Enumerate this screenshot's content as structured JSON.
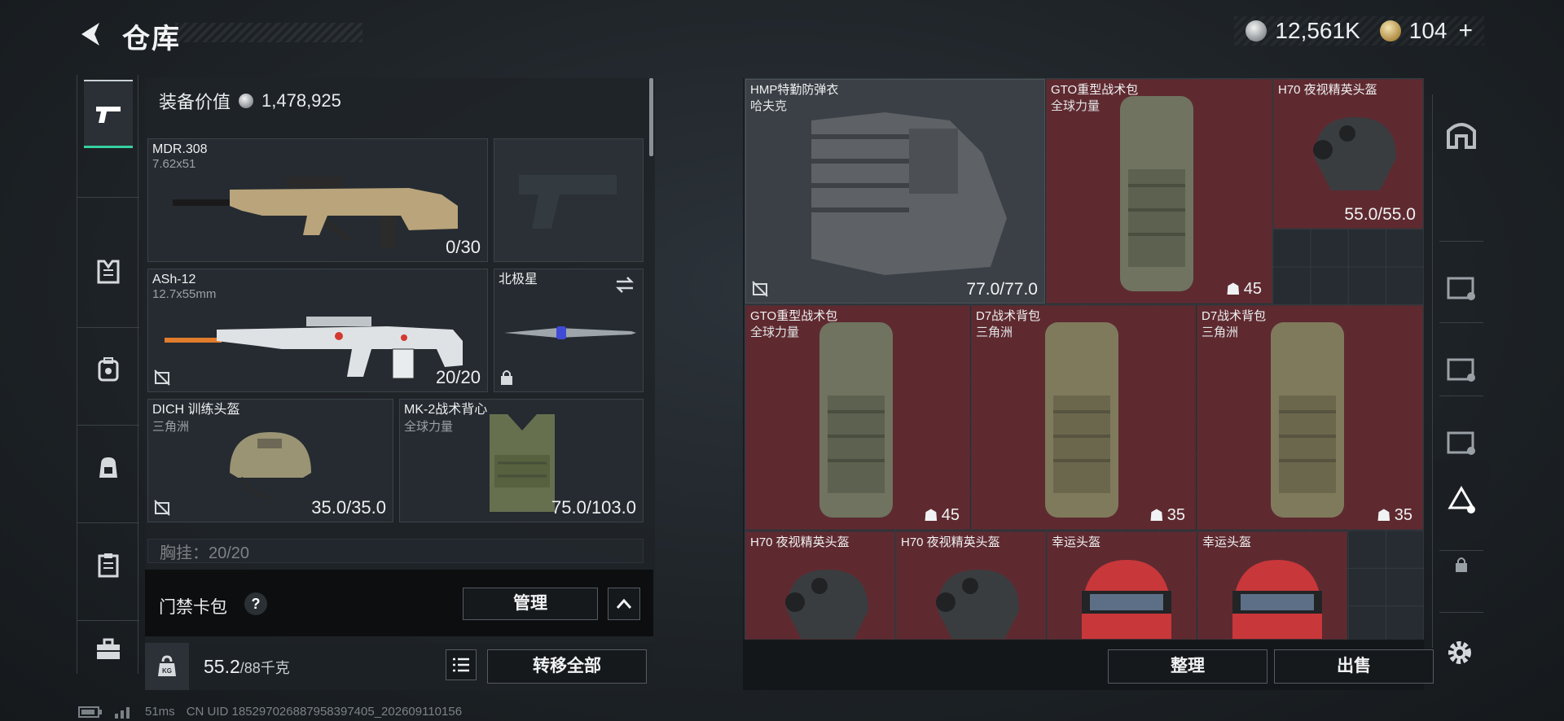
{
  "header": {
    "title": "仓库",
    "currencies": [
      {
        "icon": "silver-coin-icon",
        "value": "12,561K"
      },
      {
        "icon": "gold-coin-icon",
        "value": "104"
      }
    ],
    "add_symbol": "+"
  },
  "left_rail": {
    "tabs": [
      "pistol-icon",
      "armor-icon",
      "backpack-icon",
      "bag-icon",
      "clipboard-icon",
      "toolbox-icon"
    ],
    "active": 0
  },
  "loadout": {
    "equip_value_label": "装备价值",
    "equip_value": "1,478,925",
    "slots": {
      "primary": {
        "name": "MDR.308",
        "sub": "7.62x51",
        "count": "0/30"
      },
      "sidearm": {
        "name": "",
        "sub": "",
        "count": ""
      },
      "secondary": {
        "name": "ASh-12",
        "sub": "12.7x55mm",
        "count": "20/20"
      },
      "melee": {
        "name": "北极星",
        "sub": "",
        "count": ""
      },
      "helmet": {
        "name": "DICH 训练头盔",
        "sub": "三角洲",
        "count": "35.0/35.0"
      },
      "armor": {
        "name": "MK-2战术背心",
        "sub": "全球力量",
        "count": "75.0/103.0"
      }
    },
    "chest_rig_partial": "胸挂：20/20",
    "keycard_label": "门禁卡包",
    "help_symbol": "?",
    "manage_label": "管理",
    "weight_value": "55.2",
    "weight_max": "/88千克",
    "transfer_all_label": "转移全部"
  },
  "stash": {
    "items": [
      {
        "name": "HMP特勤防弹衣",
        "sub": "哈夫克",
        "value": "77.0/77.0"
      },
      {
        "name": "GTO重型战术包",
        "sub": "全球力量",
        "capacity": "45"
      },
      {
        "name": "H70 夜视精英头盔",
        "sub": "",
        "value": "55.0/55.0"
      },
      {
        "name": "GTO重型战术包",
        "sub": "全球力量",
        "capacity": "45"
      },
      {
        "name": "D7战术背包",
        "sub": "三角洲",
        "capacity": "35"
      },
      {
        "name": "D7战术背包",
        "sub": "三角洲",
        "capacity": "35"
      },
      {
        "name": "H70 夜视精英头盔",
        "sub": ""
      },
      {
        "name": "H70 夜视精英头盔",
        "sub": ""
      },
      {
        "name": "幸运头盔",
        "sub": ""
      },
      {
        "name": "幸运头盔",
        "sub": ""
      }
    ],
    "sort_label": "整理",
    "sell_label": "出售"
  },
  "status_bar": {
    "ping": "51ms",
    "uid": "CN UID 185297026887958397405_202609110156"
  }
}
